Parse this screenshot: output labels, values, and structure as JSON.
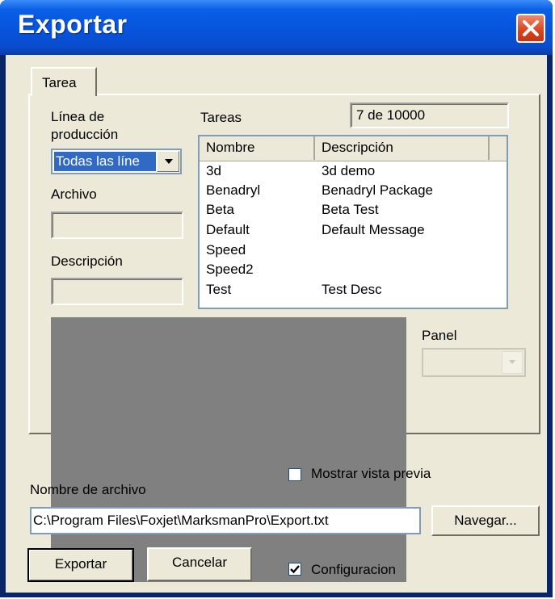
{
  "window": {
    "title": "Exportar",
    "close_icon": "close-x-icon"
  },
  "tabs": [
    {
      "label": "Tarea",
      "selected": true
    }
  ],
  "left": {
    "line_label_1": "Línea de",
    "line_label_2": "producción",
    "line_combo_value": "Todas las líne",
    "file_label": "Archivo",
    "file_value": "",
    "description_label": "Descripción",
    "description_value": ""
  },
  "tasks": {
    "label": "Tareas",
    "count": "7 de 10000",
    "columns": [
      "Nombre",
      "Descripción"
    ],
    "rows": [
      {
        "name": "3d",
        "description": "3d demo"
      },
      {
        "name": "Benadryl",
        "description": "Benadryl Package"
      },
      {
        "name": "Beta",
        "description": "Beta Test"
      },
      {
        "name": "Default",
        "description": "Default Message"
      },
      {
        "name": "Speed",
        "description": ""
      },
      {
        "name": "Speed2",
        "description": ""
      },
      {
        "name": "Test",
        "description": "Test Desc"
      }
    ]
  },
  "panel": {
    "label": "Panel",
    "value": ""
  },
  "show_preview": {
    "label": "Mostrar vista previa",
    "checked": false
  },
  "filename": {
    "label": "Nombre de archivo",
    "value": "C:\\Program Files\\Foxjet\\MarksmanPro\\Export.txt",
    "browse_button": "Navegar..."
  },
  "buttons": {
    "export": "Exportar",
    "cancel": "Cancelar"
  },
  "config": {
    "label": "Configuracion",
    "checked": true
  },
  "colors": {
    "titlebar": "#0754dc",
    "face": "#ece9d8",
    "selection": "#316ac5",
    "preview_bg": "#808080",
    "close": "#d8431f"
  }
}
